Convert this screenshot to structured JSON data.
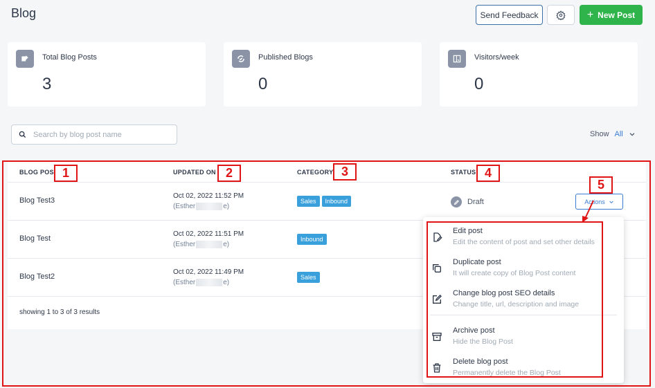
{
  "header": {
    "title": "Blog",
    "feedback_label": "Send Feedback",
    "settings_icon": "gear-icon",
    "new_post_label": "New Post"
  },
  "stats": [
    {
      "label": "Total Blog Posts",
      "value": "3",
      "icon": "blog-post-icon"
    },
    {
      "label": "Published Blogs",
      "value": "0",
      "icon": "published-icon"
    },
    {
      "label": "Visitors/week",
      "value": "0",
      "icon": "visitors-icon"
    }
  ],
  "search": {
    "placeholder": "Search by blog post name",
    "value": ""
  },
  "filter": {
    "label": "Show",
    "value": "All"
  },
  "table": {
    "headers": [
      "BLOG POST",
      "UPDATED ON",
      "CATEGORY",
      "STATUS"
    ],
    "rows": [
      {
        "name": "Blog Test3",
        "date": "Oct 02, 2022 11:52 PM",
        "author_prefix": "(Esther",
        "author_suffix": "e)",
        "categories": [
          "Sales",
          "Inbound"
        ],
        "status": "Draft",
        "actions": "Actions"
      },
      {
        "name": "Blog Test",
        "date": "Oct 02, 2022 11:51 PM",
        "author_prefix": "(Esther",
        "author_suffix": "e)",
        "categories": [
          "Inbound"
        ]
      },
      {
        "name": "Blog Test2",
        "date": "Oct 02, 2022 11:49 PM",
        "author_prefix": "(Esther",
        "author_suffix": "e)",
        "categories": [
          "Sales"
        ]
      }
    ],
    "footer": "showing 1 to 3 of 3 results"
  },
  "dropdown": [
    {
      "title": "Edit post",
      "desc": "Edit the content of post and set other details",
      "icon": "edit-document-icon"
    },
    {
      "title": "Duplicate post",
      "desc": "It will create copy of Blog Post content",
      "icon": "copy-icon"
    },
    {
      "title": "Change blog post SEO details",
      "desc": "Change title, url, description and image",
      "icon": "seo-edit-icon"
    },
    {
      "title": "Archive post",
      "desc": "Hide the Blog Post",
      "icon": "archive-icon"
    },
    {
      "title": "Delete blog post",
      "desc": "Permanently delete the Blog Post",
      "icon": "trash-icon"
    }
  ],
  "annotations": [
    "1",
    "2",
    "3",
    "4",
    "5"
  ],
  "colors": {
    "accent": "#3b7bd4",
    "primary_button": "#2eb44a",
    "tag": "#3aa0dc",
    "annotation": "#e01414"
  }
}
